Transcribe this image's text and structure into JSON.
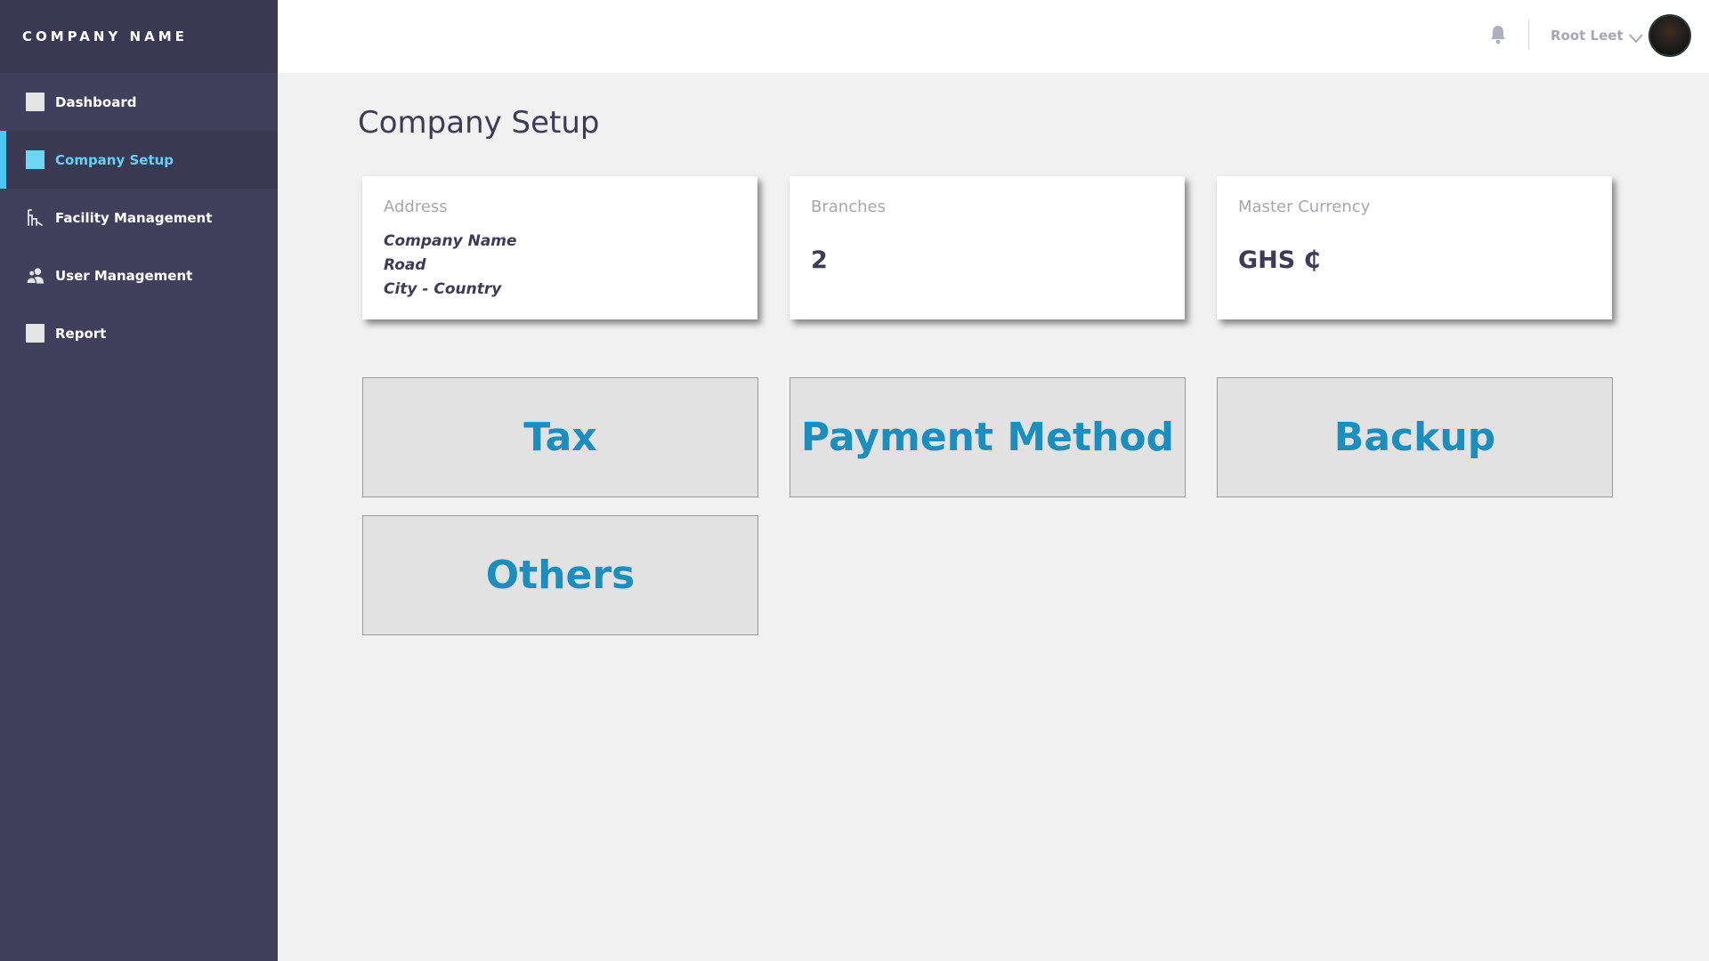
{
  "sidebar": {
    "brand": "COMPANY NAME",
    "items": [
      {
        "label": "Dashboard",
        "icon": "square-icon",
        "active": false
      },
      {
        "label": "Company Setup",
        "icon": "square-icon",
        "active": true
      },
      {
        "label": "Facility Management",
        "icon": "facility-icon",
        "active": false
      },
      {
        "label": "User Management",
        "icon": "users-icon",
        "active": false
      },
      {
        "label": "Report",
        "icon": "square-icon",
        "active": false
      }
    ]
  },
  "header": {
    "user_name": "Root Leet",
    "icons": [
      "bell-icon",
      "chevron-down-icon",
      "avatar"
    ]
  },
  "main": {
    "title": "Company Setup",
    "cards": {
      "address": {
        "label": "Address",
        "lines": [
          "Company Name",
          "Road",
          "City - Country"
        ]
      },
      "branches": {
        "label": "Branches",
        "value": "2"
      },
      "currency": {
        "label": "Master Currency",
        "value": "GHS ₵"
      }
    },
    "tiles": [
      "Tax",
      "Payment Method",
      "Backup",
      "Others"
    ]
  },
  "colors": {
    "sidebar_bg": "#413f5c",
    "sidebar_dark": "#3a3852",
    "accent": "#4ac7f2",
    "tile_text": "#1a8fbe",
    "page_bg": "#f1f1f1"
  }
}
